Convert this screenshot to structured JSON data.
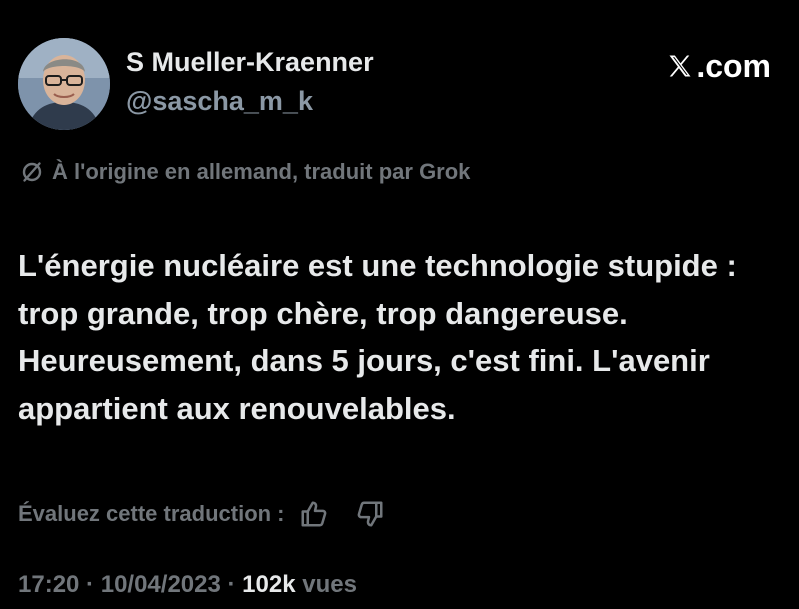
{
  "author": {
    "display_name": "S Mueller-Kraenner",
    "handle": "@sascha_m_k",
    "avatar_icon": "person-photo"
  },
  "brand": {
    "label": ".com",
    "icon": "x-logo-icon"
  },
  "translation_note": {
    "text": "À l'origine en allemand, traduit par Grok",
    "icon": "translate-slash-icon"
  },
  "tweet": {
    "text": "L'énergie nucléaire est une technologie stupide : trop grande, trop chère, trop dangereuse. Heureusement, dans 5 jours, c'est fini. L'avenir appartient aux renouvelables."
  },
  "rating": {
    "label": "Évaluez cette traduction :",
    "thumbs_up_icon": "thumbs-up-icon",
    "thumbs_down_icon": "thumbs-down-icon"
  },
  "meta": {
    "time": "17:20",
    "separator": " · ",
    "date": "10/04/2023",
    "views_count": "102k",
    "views_label": "vues"
  },
  "colors": {
    "background": "#000000",
    "primary_text": "#e7e9ea",
    "secondary_text": "#71767b"
  }
}
